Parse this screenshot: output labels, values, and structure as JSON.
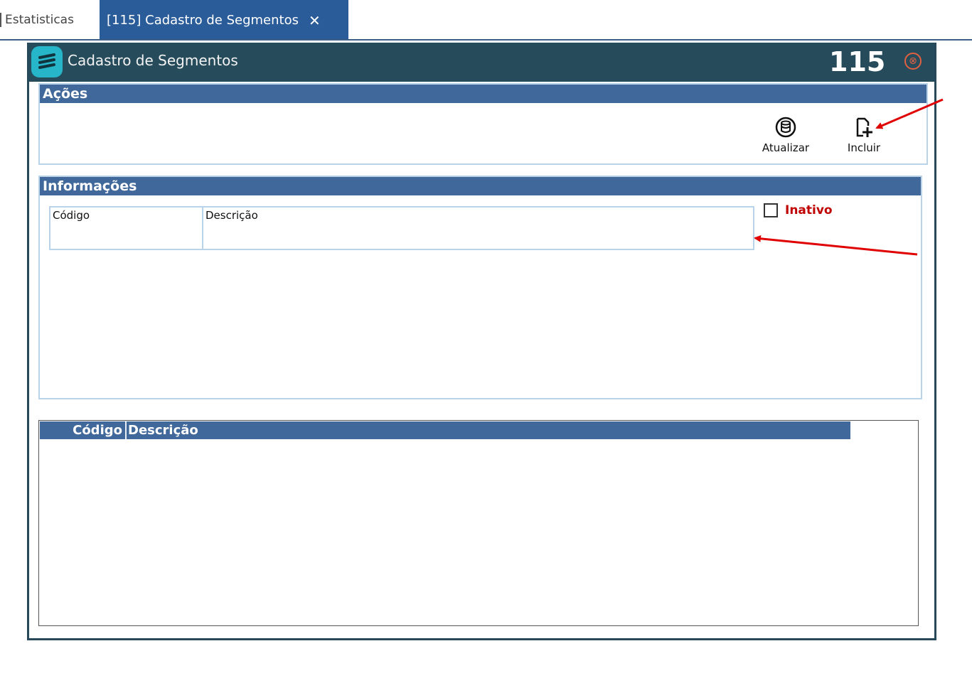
{
  "tabs": {
    "inactive_label": "Estatisticas",
    "active_label": "[115] Cadastro de Segmentos",
    "close_glyph": "✕"
  },
  "window": {
    "title": "Cadastro de Segmentos",
    "code": "115",
    "close_glyph": "⊗",
    "logo_icon": "segments-logo-icon"
  },
  "acoes": {
    "header": "Ações",
    "buttons": [
      {
        "label": "Atualizar",
        "icon": "refresh-database-icon"
      },
      {
        "label": "Incluir",
        "icon": "add-document-icon"
      }
    ]
  },
  "informacoes": {
    "header": "Informações",
    "fields": {
      "codigo_label": "Código",
      "codigo_value": "",
      "descricao_label": "Descrição",
      "descricao_value": ""
    },
    "inativo_label": "Inativo",
    "inativo_checked": false
  },
  "grid": {
    "columns": [
      "Código",
      "Descrição"
    ],
    "rows": []
  },
  "colors": {
    "titlebar": "#264c5c",
    "group_header": "#41689a",
    "active_tab": "#2b5c9a",
    "annotation_arrow": "#e00000",
    "inativo_text": "#c00000"
  }
}
